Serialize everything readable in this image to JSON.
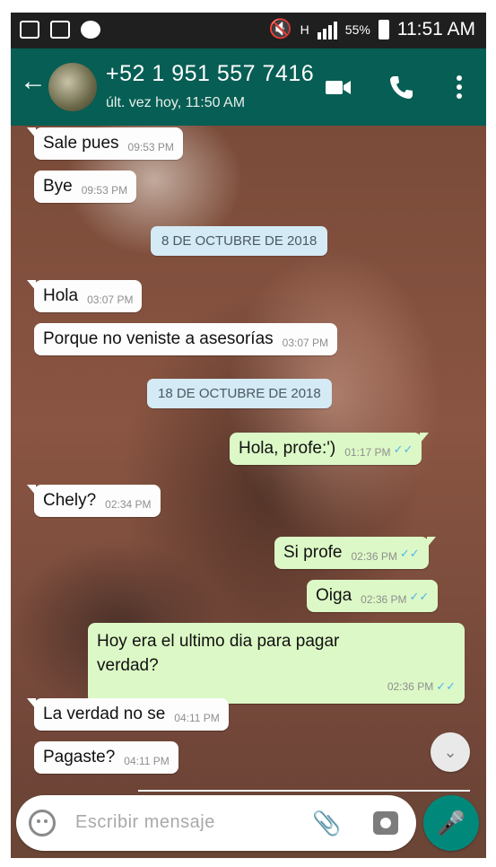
{
  "status_bar": {
    "battery": "55%",
    "network": "H",
    "time": "11:51 AM"
  },
  "header": {
    "contact_name": "+52 1 951 557 7416",
    "last_seen": "últ. vez hoy, 11:50 AM",
    "icons": [
      "back-arrow-icon",
      "video-call-icon",
      "phone-icon",
      "more-vert-icon"
    ]
  },
  "messages": [
    {
      "dir": "in",
      "text": "Sale pues",
      "time": "09:53 PM"
    },
    {
      "dir": "in",
      "text": "Bye",
      "time": "09:53 PM"
    },
    {
      "dir": "date",
      "text": "8 DE OCTUBRE DE 2018"
    },
    {
      "dir": "in",
      "text": "Hola",
      "time": "03:07 PM"
    },
    {
      "dir": "in",
      "text": "Porque no veniste a asesorías",
      "time": "03:07 PM"
    },
    {
      "dir": "date",
      "text": "18 DE OCTUBRE DE 2018"
    },
    {
      "dir": "out",
      "text": "Hola, profe:')",
      "time": "01:17 PM",
      "read": true
    },
    {
      "dir": "in",
      "text": "Chely?",
      "time": "02:34 PM"
    },
    {
      "dir": "out",
      "text": "Si profe",
      "time": "02:36 PM",
      "read": true
    },
    {
      "dir": "out",
      "text": "Oiga",
      "time": "02:36 PM",
      "read": true
    },
    {
      "dir": "out",
      "text": "Hoy era el ultimo dia para pagar verdad?",
      "time": "02:36 PM",
      "read": true
    },
    {
      "dir": "in",
      "text": "La verdad no se",
      "time": "04:11 PM"
    },
    {
      "dir": "in",
      "text": "Pagaste?",
      "time": "04:11 PM"
    }
  ],
  "input": {
    "placeholder": "Escribir mensaje"
  },
  "colors": {
    "header": "#075e54",
    "out_bubble": "#dcf8c6",
    "in_bubble": "#fdfdfd",
    "date_chip": "#d4eaf4",
    "mic_button": "#00897b",
    "read_tick": "#4fb6ec"
  }
}
